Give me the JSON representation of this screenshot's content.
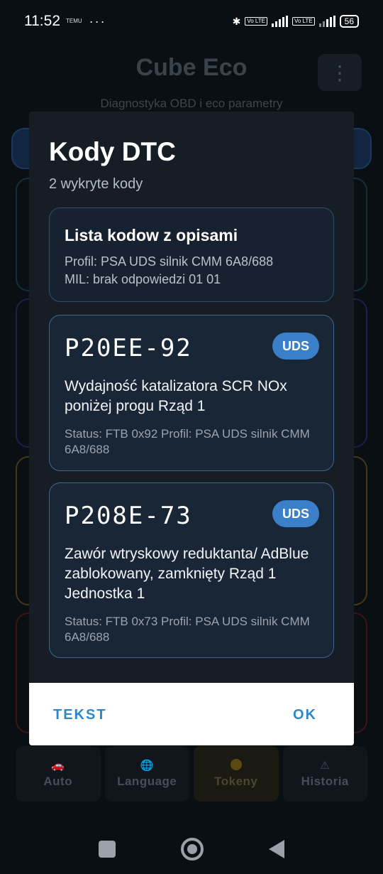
{
  "status_bar": {
    "time": "11:52",
    "mini_text": "TEMU",
    "dots": "···",
    "lte": "LTE",
    "volte": "Vo LTE",
    "battery": "56"
  },
  "app": {
    "title": "Cube Eco",
    "subtitle": "Diagnostyka OBD i eco parametry",
    "menu_icon": "⋮"
  },
  "dialog": {
    "title": "Kody DTC",
    "subtitle": "2 wykryte kody",
    "summary": {
      "title": "Lista kodow z opisami",
      "profile": "Profil: PSA UDS silnik CMM 6A8/688",
      "mil": "MIL: brak odpowiedzi 01 01"
    },
    "codes": [
      {
        "code": "P20EE-92",
        "badge": "UDS",
        "description": "Wydajność katalizatora SCR NOx poniżej progu Rząd 1",
        "status": "Status: FTB 0x92   Profil: PSA UDS silnik CMM 6A8/688"
      },
      {
        "code": "P208E-73",
        "badge": "UDS",
        "description": "Zawór wtryskowy reduktanta/ AdBlue zablokowany, zamknięty Rząd 1 Jednostka 1",
        "status": "Status: FTB 0x73   Profil: PSA UDS silnik CMM 6A8/688"
      }
    ],
    "actions": {
      "text_label": "TEKST",
      "ok_label": "OK"
    }
  },
  "bottom_nav": {
    "items": [
      {
        "label": "Auto",
        "icon": "car-icon"
      },
      {
        "label": "Language",
        "icon": "globe-icon"
      },
      {
        "label": "Tokeny",
        "icon": "coin-icon"
      },
      {
        "label": "Historia",
        "icon": "warning-icon"
      }
    ]
  },
  "colors": {
    "accent": "#2f86c8",
    "badge": "#3a7fc8",
    "dialog_bg": "#161d25",
    "card_border": "#3e6690"
  }
}
